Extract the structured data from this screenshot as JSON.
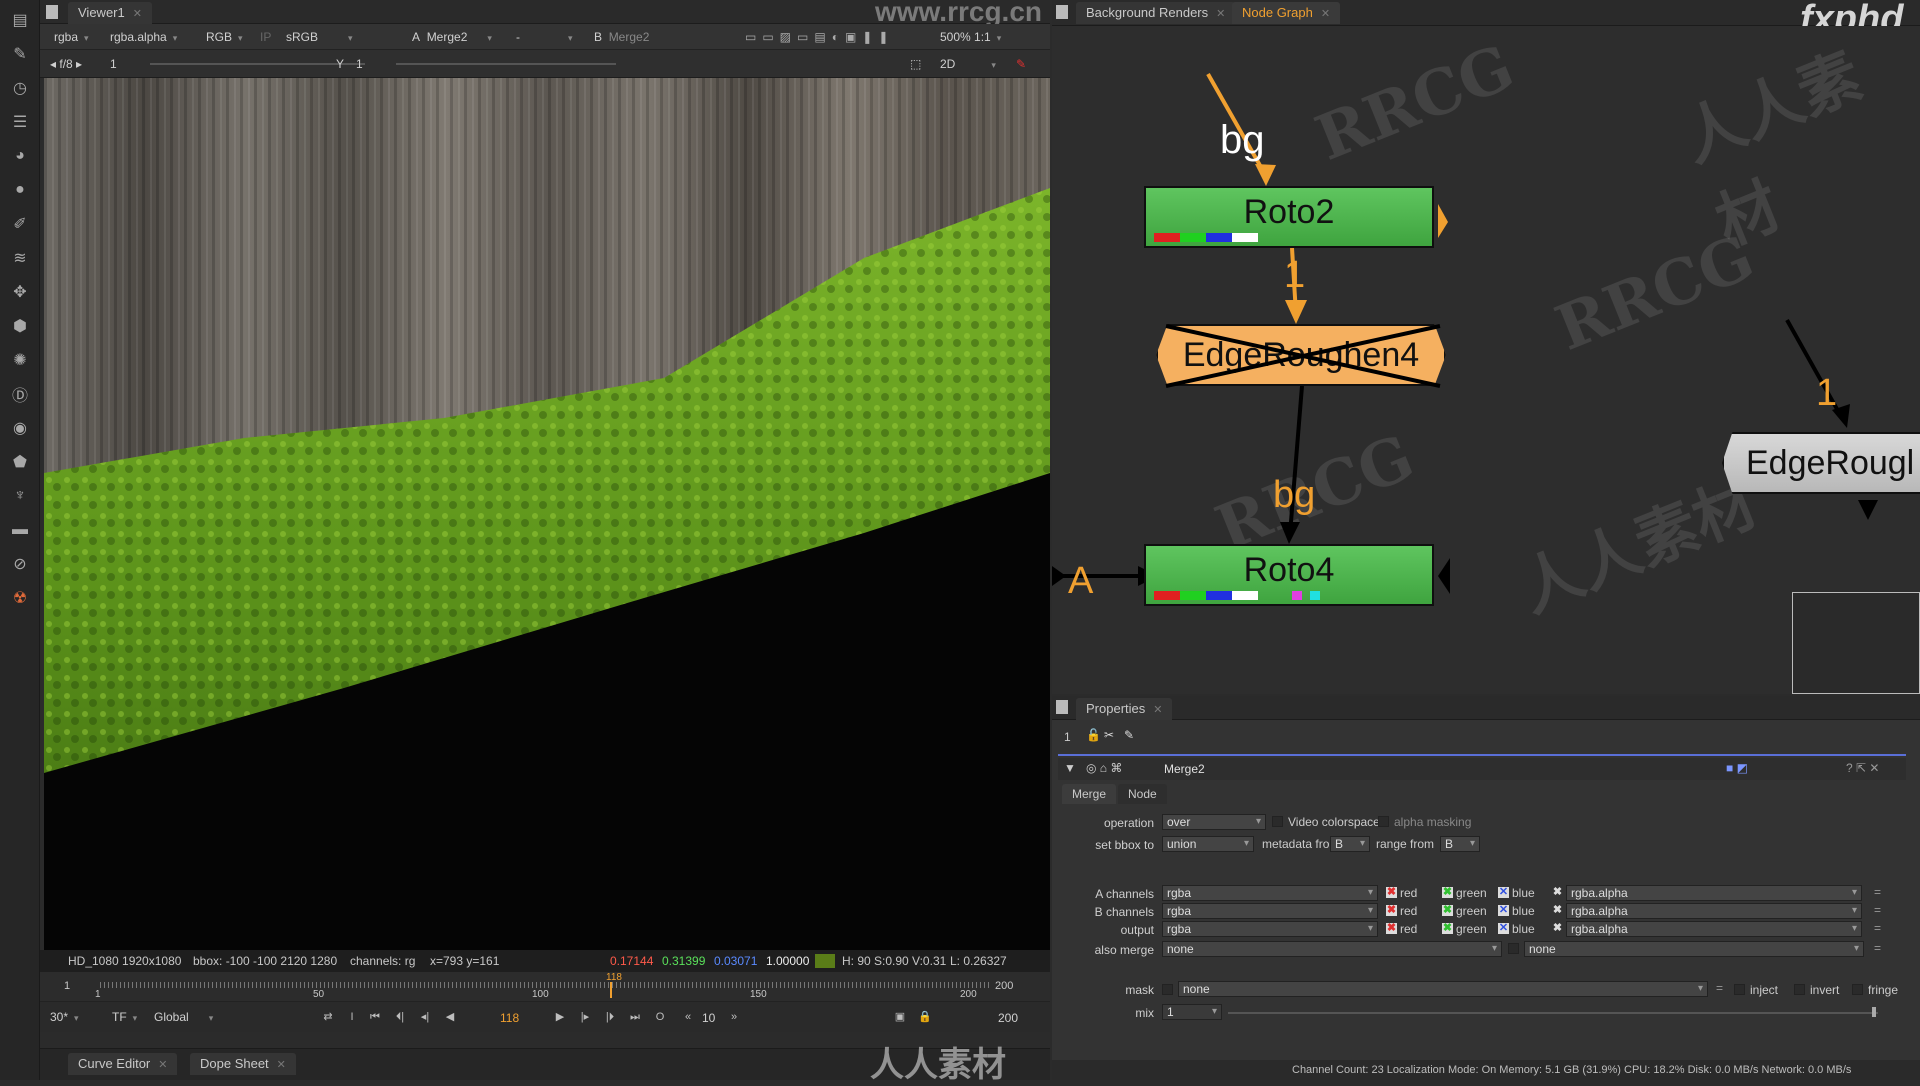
{
  "viewer": {
    "tab_label": "Viewer1",
    "channels": "rgba",
    "channel_alpha": "rgba.alpha",
    "display": "RGB",
    "ip": "IP",
    "lut": "sRGB",
    "input_a_label": "A",
    "input_a": "Merge2",
    "dash": "-",
    "input_b_label": "B",
    "input_b": "Merge2",
    "zoom": "500%",
    "ratio": "1:1",
    "fstop": "f/8",
    "gain": "1",
    "gamma_label": "Y",
    "gamma": "1",
    "view_mode": "2D",
    "watermark": "www.rrcg.cn"
  },
  "info": {
    "format": "HD_1080 1920x1080",
    "bbox": "bbox: -100 -100 2120 1280",
    "channels": "channels: rg",
    "coords": "x=793 y=161",
    "r": "0.17144",
    "g": "0.31399",
    "b": "0.03071",
    "a": "1.00000",
    "hsv": "H: 90 S:0.90 V:0.31",
    "lum": "L: 0.26327",
    "swatch_color": "#5a7d18"
  },
  "timeline": {
    "start": "1",
    "end": "200",
    "current": "118",
    "ticks": [
      "1",
      "50",
      "100",
      "150",
      "200"
    ],
    "fps": "30*",
    "tf": "TF",
    "scope": "Global",
    "frame": "118",
    "step": "10",
    "end_field": "200"
  },
  "bottom_tabs": [
    "Curve Editor",
    "Dope Sheet"
  ],
  "nodegraph": {
    "tabs": [
      "Background Renders",
      "Node Graph"
    ],
    "logo": "fxphd",
    "nodes": [
      {
        "label": "Roto2"
      },
      {
        "label": "EdgeRoughen4"
      },
      {
        "label": "Roto4"
      },
      {
        "label": "EdgeRougl"
      }
    ],
    "edge_labels": {
      "bg_top": "bg",
      "one_mid": "1",
      "bg_mid": "bg",
      "a": "A",
      "one_right": "1"
    },
    "watermarks": [
      "RRCG",
      "人人素材"
    ]
  },
  "properties": {
    "tab_label": "Properties",
    "node_count": "1",
    "node_name": "Merge2",
    "subtabs": [
      "Merge",
      "Node"
    ],
    "operation_label": "operation",
    "operation": "over",
    "video_colorspace": "Video colorspace",
    "alpha_masking": "alpha masking",
    "set_bbox_label": "set bbox to",
    "set_bbox": "union",
    "metadata_label": "metadata from",
    "metadata": "B",
    "range_label": "range from",
    "range": "B",
    "channel_rows": [
      {
        "label": "A channels",
        "value": "rgba",
        "alpha": "rgba.alpha"
      },
      {
        "label": "B channels",
        "value": "rgba",
        "alpha": "rgba.alpha"
      },
      {
        "label": "output",
        "value": "rgba",
        "alpha": "rgba.alpha"
      }
    ],
    "channel_names": [
      "red",
      "green",
      "blue"
    ],
    "also_merge_label": "also merge",
    "also_merge": "none",
    "also_merge2": "none",
    "mask_label": "mask",
    "mask": "none",
    "inject": "inject",
    "invert": "invert",
    "fringe": "fringe",
    "mix_label": "mix",
    "mix": "1"
  },
  "status": "Channel Count: 23  Localization Mode: On  Memory: 5.1 GB (31.9%)  CPU: 18.2%  Disk: 0.0 MB/s  Network: 0.0 MB/s",
  "footer_watermark": "人人素材"
}
